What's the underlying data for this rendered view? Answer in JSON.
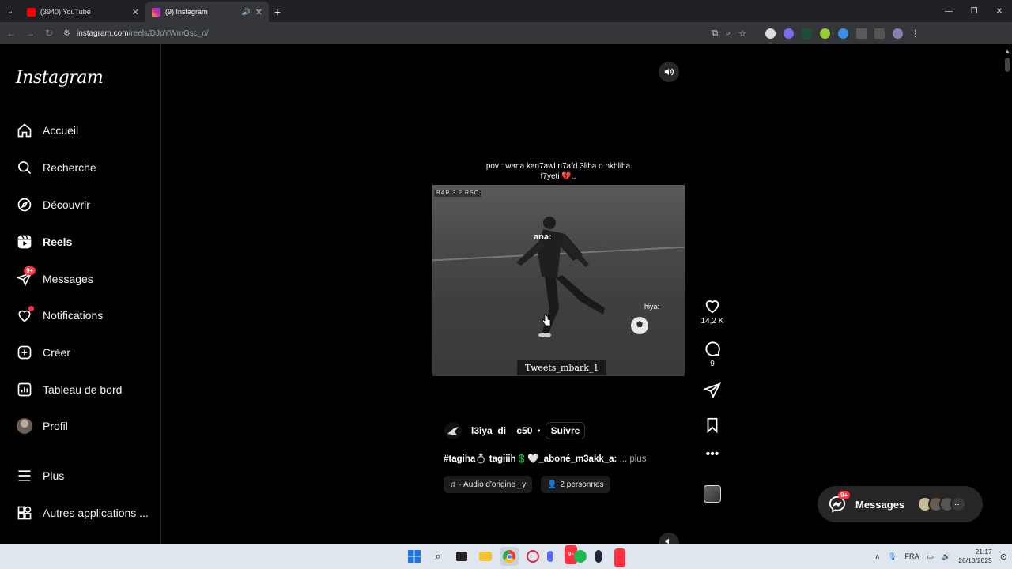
{
  "browser": {
    "tabs": [
      {
        "title": "(3940) YouTube",
        "icon": "youtube-icon",
        "color": "#ff0000"
      },
      {
        "title": "(9) Instagram",
        "icon": "instagram-icon",
        "color": "#d6249f"
      }
    ],
    "url_domain": "instagram.com",
    "url_path": "/reels/DJpYWmGsc_o/"
  },
  "sidebar": {
    "logo": "Instagram",
    "items": [
      {
        "label": "Accueil",
        "icon": "home-icon"
      },
      {
        "label": "Recherche",
        "icon": "search-icon"
      },
      {
        "label": "Découvrir",
        "icon": "compass-icon"
      },
      {
        "label": "Reels",
        "icon": "reels-icon"
      },
      {
        "label": "Messages",
        "icon": "messenger-icon",
        "badge": "9+"
      },
      {
        "label": "Notifications",
        "icon": "heart-icon"
      },
      {
        "label": "Créer",
        "icon": "plus-square-icon"
      },
      {
        "label": "Tableau de bord",
        "icon": "dashboard-icon"
      },
      {
        "label": "Profil",
        "icon": "avatar"
      },
      {
        "label": "Plus",
        "icon": "menu-icon"
      },
      {
        "label": "Autres applications ...",
        "icon": "apps-icon"
      }
    ]
  },
  "reel": {
    "caption_line1": "pov : wana kan7awl n7afd 3liha o nkhliha",
    "caption_line2": "f7yeti 💔..",
    "scorebug": "BAR  3  2  RSO",
    "overlay_ana": "ana:",
    "overlay_hiya": "hiya:",
    "watermark": "Tweets_mbark_1",
    "likes": "14,2 K",
    "comments": "9",
    "author": "l3iya_di__c50",
    "follow": "Suivre",
    "description": "#tagiha💍 tagiiih💲🤍_aboné_m3akk_a:",
    "more": "... plus",
    "audio": "· Audio d'origine _y",
    "people": "2 personnes"
  },
  "messages_pill": {
    "label": "Messages",
    "badge": "9+"
  },
  "taskbar": {
    "lang": "FRA",
    "time": "21:17",
    "date": "26/10/2025",
    "badge": "9+"
  }
}
